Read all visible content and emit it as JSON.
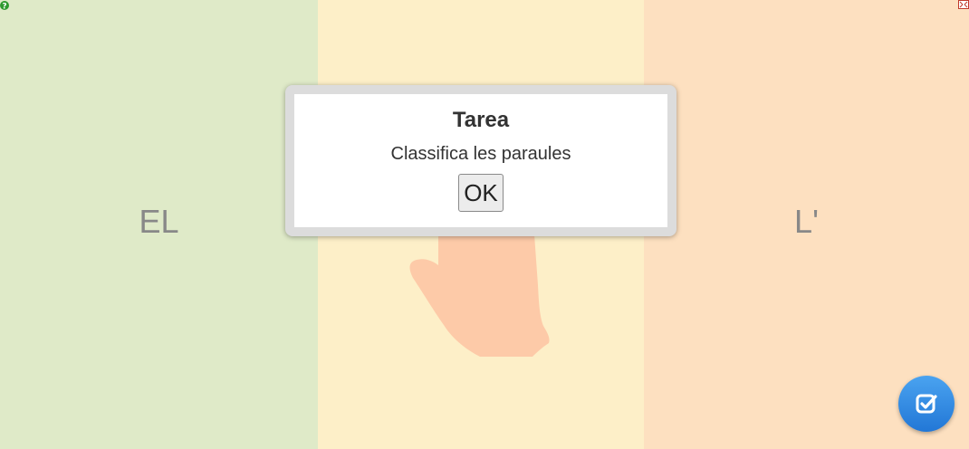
{
  "columns": [
    {
      "label": "EL",
      "color": "#dfeac8"
    },
    {
      "label": "",
      "color": "#fdefc8"
    },
    {
      "label": "L'",
      "color": "#fde0c0"
    }
  ],
  "dialog": {
    "title": "Tarea",
    "message": "Classifica les paraules",
    "ok_label": "OK"
  },
  "icons": {
    "top_left": "help-icon",
    "top_right": "fullscreen-icon",
    "bottom_right": "check-icon",
    "center": "hand-pointer-icon"
  },
  "colors": {
    "accent": "#2b84e0",
    "hand": "#fdcaa8"
  }
}
